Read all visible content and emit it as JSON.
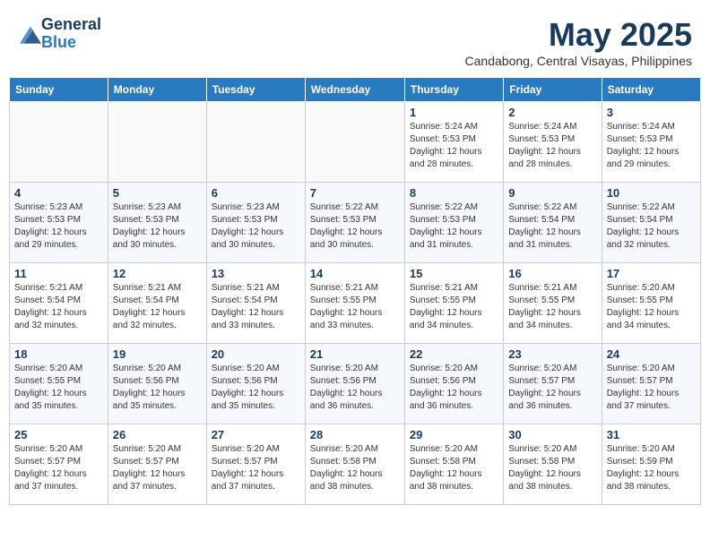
{
  "header": {
    "logo_general": "General",
    "logo_blue": "Blue",
    "month_title": "May 2025",
    "location": "Candabong, Central Visayas, Philippines"
  },
  "weekdays": [
    "Sunday",
    "Monday",
    "Tuesday",
    "Wednesday",
    "Thursday",
    "Friday",
    "Saturday"
  ],
  "weeks": [
    [
      {
        "day": "",
        "info": ""
      },
      {
        "day": "",
        "info": ""
      },
      {
        "day": "",
        "info": ""
      },
      {
        "day": "",
        "info": ""
      },
      {
        "day": "1",
        "info": "Sunrise: 5:24 AM\nSunset: 5:53 PM\nDaylight: 12 hours\nand 28 minutes."
      },
      {
        "day": "2",
        "info": "Sunrise: 5:24 AM\nSunset: 5:53 PM\nDaylight: 12 hours\nand 28 minutes."
      },
      {
        "day": "3",
        "info": "Sunrise: 5:24 AM\nSunset: 5:53 PM\nDaylight: 12 hours\nand 29 minutes."
      }
    ],
    [
      {
        "day": "4",
        "info": "Sunrise: 5:23 AM\nSunset: 5:53 PM\nDaylight: 12 hours\nand 29 minutes."
      },
      {
        "day": "5",
        "info": "Sunrise: 5:23 AM\nSunset: 5:53 PM\nDaylight: 12 hours\nand 30 minutes."
      },
      {
        "day": "6",
        "info": "Sunrise: 5:23 AM\nSunset: 5:53 PM\nDaylight: 12 hours\nand 30 minutes."
      },
      {
        "day": "7",
        "info": "Sunrise: 5:22 AM\nSunset: 5:53 PM\nDaylight: 12 hours\nand 30 minutes."
      },
      {
        "day": "8",
        "info": "Sunrise: 5:22 AM\nSunset: 5:53 PM\nDaylight: 12 hours\nand 31 minutes."
      },
      {
        "day": "9",
        "info": "Sunrise: 5:22 AM\nSunset: 5:54 PM\nDaylight: 12 hours\nand 31 minutes."
      },
      {
        "day": "10",
        "info": "Sunrise: 5:22 AM\nSunset: 5:54 PM\nDaylight: 12 hours\nand 32 minutes."
      }
    ],
    [
      {
        "day": "11",
        "info": "Sunrise: 5:21 AM\nSunset: 5:54 PM\nDaylight: 12 hours\nand 32 minutes."
      },
      {
        "day": "12",
        "info": "Sunrise: 5:21 AM\nSunset: 5:54 PM\nDaylight: 12 hours\nand 32 minutes."
      },
      {
        "day": "13",
        "info": "Sunrise: 5:21 AM\nSunset: 5:54 PM\nDaylight: 12 hours\nand 33 minutes."
      },
      {
        "day": "14",
        "info": "Sunrise: 5:21 AM\nSunset: 5:55 PM\nDaylight: 12 hours\nand 33 minutes."
      },
      {
        "day": "15",
        "info": "Sunrise: 5:21 AM\nSunset: 5:55 PM\nDaylight: 12 hours\nand 34 minutes."
      },
      {
        "day": "16",
        "info": "Sunrise: 5:21 AM\nSunset: 5:55 PM\nDaylight: 12 hours\nand 34 minutes."
      },
      {
        "day": "17",
        "info": "Sunrise: 5:20 AM\nSunset: 5:55 PM\nDaylight: 12 hours\nand 34 minutes."
      }
    ],
    [
      {
        "day": "18",
        "info": "Sunrise: 5:20 AM\nSunset: 5:55 PM\nDaylight: 12 hours\nand 35 minutes."
      },
      {
        "day": "19",
        "info": "Sunrise: 5:20 AM\nSunset: 5:56 PM\nDaylight: 12 hours\nand 35 minutes."
      },
      {
        "day": "20",
        "info": "Sunrise: 5:20 AM\nSunset: 5:56 PM\nDaylight: 12 hours\nand 35 minutes."
      },
      {
        "day": "21",
        "info": "Sunrise: 5:20 AM\nSunset: 5:56 PM\nDaylight: 12 hours\nand 36 minutes."
      },
      {
        "day": "22",
        "info": "Sunrise: 5:20 AM\nSunset: 5:56 PM\nDaylight: 12 hours\nand 36 minutes."
      },
      {
        "day": "23",
        "info": "Sunrise: 5:20 AM\nSunset: 5:57 PM\nDaylight: 12 hours\nand 36 minutes."
      },
      {
        "day": "24",
        "info": "Sunrise: 5:20 AM\nSunset: 5:57 PM\nDaylight: 12 hours\nand 37 minutes."
      }
    ],
    [
      {
        "day": "25",
        "info": "Sunrise: 5:20 AM\nSunset: 5:57 PM\nDaylight: 12 hours\nand 37 minutes."
      },
      {
        "day": "26",
        "info": "Sunrise: 5:20 AM\nSunset: 5:57 PM\nDaylight: 12 hours\nand 37 minutes."
      },
      {
        "day": "27",
        "info": "Sunrise: 5:20 AM\nSunset: 5:57 PM\nDaylight: 12 hours\nand 37 minutes."
      },
      {
        "day": "28",
        "info": "Sunrise: 5:20 AM\nSunset: 5:58 PM\nDaylight: 12 hours\nand 38 minutes."
      },
      {
        "day": "29",
        "info": "Sunrise: 5:20 AM\nSunset: 5:58 PM\nDaylight: 12 hours\nand 38 minutes."
      },
      {
        "day": "30",
        "info": "Sunrise: 5:20 AM\nSunset: 5:58 PM\nDaylight: 12 hours\nand 38 minutes."
      },
      {
        "day": "31",
        "info": "Sunrise: 5:20 AM\nSunset: 5:59 PM\nDaylight: 12 hours\nand 38 minutes."
      }
    ]
  ]
}
